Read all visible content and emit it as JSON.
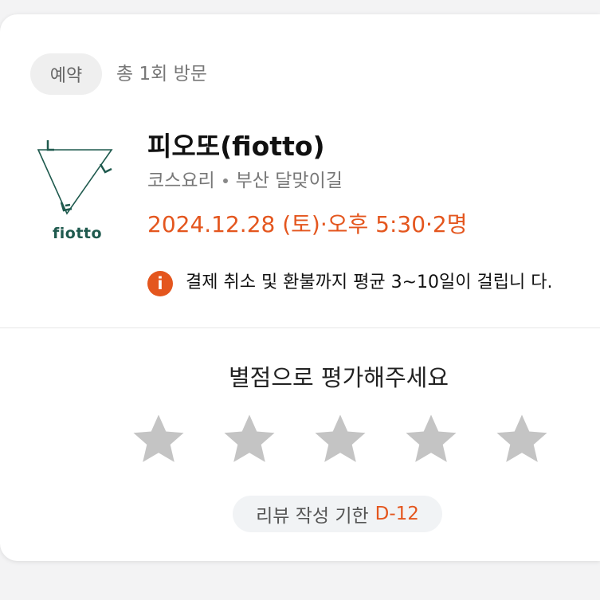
{
  "header": {
    "badge_label": "예약",
    "visit_count_text": "총 1회 방문"
  },
  "shop": {
    "logo_text": "fiotto",
    "name": "피오또(fiotto)",
    "category": "코스요리",
    "location": "부산 달맞이길"
  },
  "booking": {
    "summary": "2024.12.28 (토)·오후 5:30·2명"
  },
  "notice": {
    "icon": "info-icon",
    "icon_glyph": "i",
    "text": "결제 취소 및 환불까지 평균 3~10일이 걸립니 다."
  },
  "rating": {
    "title": "별점으로 평가해주세요",
    "stars_total": 5,
    "stars_selected": 0
  },
  "review_deadline": {
    "label": "리뷰 작성 기한",
    "value": "D-12"
  },
  "colors": {
    "accent": "#e4561e",
    "brand_green": "#1f5a4e",
    "star_empty": "#c4c4c4"
  }
}
